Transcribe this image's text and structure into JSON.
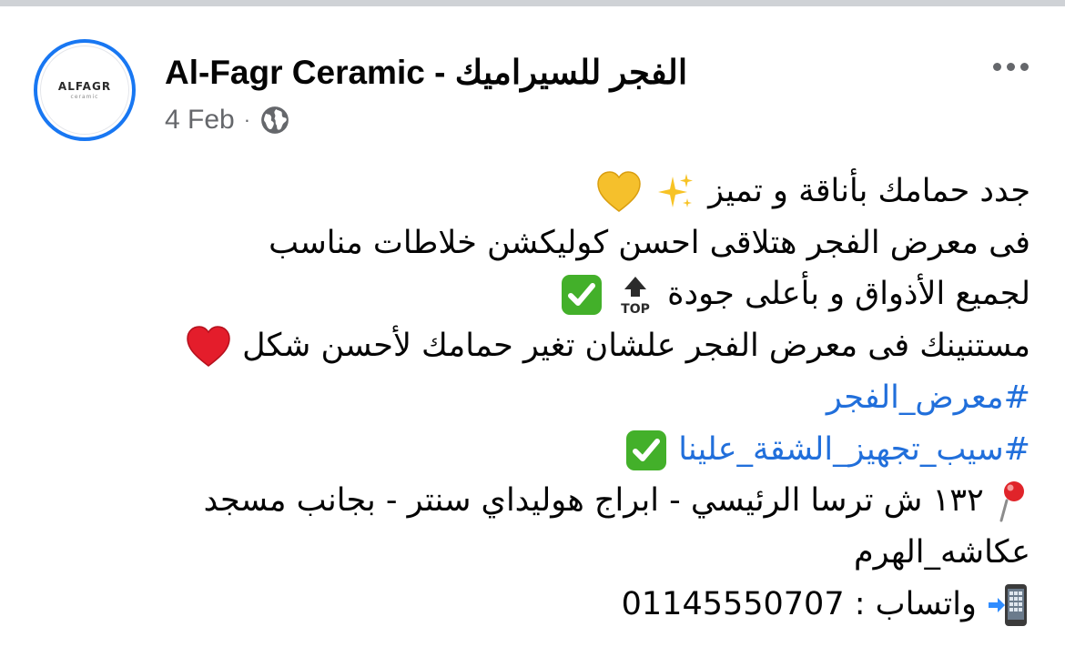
{
  "header": {
    "page_name": "Al-Fagr Ceramic -  الفجر للسيراميك",
    "date": "4 Feb",
    "separator": "·",
    "avatar_logo_text": "ALFAGR",
    "avatar_logo_sub": "ceramic",
    "more_icon": "more-horizontal-icon",
    "audience_icon": "globe-icon"
  },
  "post": {
    "line1": "جدد حمامك بأناقة و تميز",
    "line2": "فى معرض الفجر هتلاقى احسن كوليكشن خلاطات مناسب",
    "line3": "لجميع الأذواق و بأعلى جودة",
    "line4": "مستنينك فى معرض الفجر علشان تغير حمامك لأحسن شكل",
    "hashtag1": "#معرض_الفجر",
    "hashtag2": "#سيب_تجهيز_الشقة_علينا",
    "address_line": "١٣٢ ش ترسا الرئيسي - ابراج هوليداي سنتر - بجانب مسجد",
    "address_line2": "عكاشه_الهرم",
    "whatsapp_label": "واتساب :",
    "phone": "01145550707"
  },
  "colors": {
    "accent": "#1877f2",
    "hashtag": "#216fdb",
    "meta_text": "#65676b"
  }
}
